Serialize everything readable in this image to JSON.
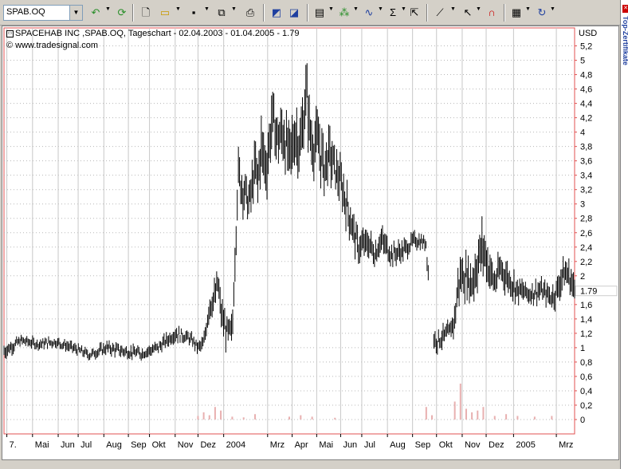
{
  "toolbar": {
    "symbol": "SPAB.OQ",
    "icons": [
      "undo-arrow-icon",
      "refresh-icon",
      "new-document-icon",
      "open-folder-icon",
      "save-icon",
      "copy-icon",
      "print-icon",
      "chart-in-icon",
      "chart-out-icon",
      "window-layout-icon",
      "indicator-icon",
      "study-icon",
      "sigma-icon",
      "export-icon",
      "draw-line-icon",
      "cursor-icon",
      "magnet-icon",
      "notes-icon",
      "rotate-icon"
    ]
  },
  "side": {
    "label": "Top-Zertifikate"
  },
  "chart": {
    "title": "SPACEHAB INC ,SPAB.OQ, Tageschart - 02.04.2003 - 01.04.2005 - 1.79",
    "source": "© www.tradesignal.com",
    "unit": "USD",
    "last_price_label": "1.79"
  },
  "chart_data": {
    "type": "bar",
    "title": "SPACEHAB INC ,SPAB.OQ, Tageschart - 02.04.2003 - 01.04.2005 - 1.79",
    "ylabel": "USD",
    "ylim": [
      -0.2,
      5.45
    ],
    "price_ticks": [
      5.2,
      5,
      4.8,
      4.6,
      4.4,
      4.2,
      4,
      3.8,
      3.6,
      3.4,
      3.2,
      3,
      2.8,
      2.6,
      2.4,
      2.2,
      2,
      1.79,
      1.6,
      1.4,
      1.2,
      1,
      0.8,
      0.6,
      0.4,
      0.2,
      0
    ],
    "price_tick_labels": [
      "5,2",
      "5",
      "4,8",
      "4,6",
      "4,4",
      "4,2",
      "4",
      "3,8",
      "3,6",
      "3,4",
      "3,2",
      "3",
      "2,8",
      "2,6",
      "2,4",
      "2,2",
      "2",
      "1.79",
      "1,6",
      "1,4",
      "1,2",
      "1",
      "0,8",
      "0,6",
      "0,4",
      "0,2",
      "0"
    ],
    "last_price": 1.79,
    "x_tick_labels": [
      "7.",
      "Mai",
      "Jun",
      "Jul",
      "Aug",
      "Sep",
      "Okt",
      "Nov",
      "Dez",
      "2004",
      "Mrz",
      "Apr",
      "Mai",
      "Jun",
      "Jul",
      "Aug",
      "Sep",
      "Okt",
      "Nov",
      "Dez",
      "2005",
      "Mrz"
    ],
    "x_tick_frac": [
      0.005,
      0.05,
      0.095,
      0.13,
      0.175,
      0.218,
      0.255,
      0.3,
      0.34,
      0.385,
      0.462,
      0.505,
      0.548,
      0.59,
      0.627,
      0.672,
      0.716,
      0.758,
      0.803,
      0.845,
      0.893,
      0.968
    ],
    "price_series": {
      "name": "SPAB.OQ",
      "t": [
        0,
        0.03,
        0.06,
        0.09,
        0.12,
        0.15,
        0.18,
        0.21,
        0.24,
        0.27,
        0.3,
        0.32,
        0.33,
        0.34,
        0.35,
        0.36,
        0.37,
        0.375,
        0.38,
        0.39,
        0.4,
        0.41,
        0.42,
        0.43,
        0.44,
        0.445,
        0.45,
        0.46,
        0.47,
        0.48,
        0.49,
        0.5,
        0.51,
        0.52,
        0.53,
        0.535,
        0.54,
        0.55,
        0.56,
        0.57,
        0.58,
        0.59,
        0.6,
        0.62,
        0.64,
        0.65,
        0.66,
        0.67,
        0.68,
        0.7,
        0.72,
        0.74,
        0.745,
        0.75,
        0.755,
        0.76,
        0.77,
        0.78,
        0.79,
        0.795,
        0.8,
        0.81,
        0.82,
        0.83,
        0.84,
        0.85,
        0.86,
        0.87,
        0.88,
        0.9,
        0.92,
        0.94,
        0.95,
        0.96,
        0.97,
        0.98,
        0.99,
        1.0
      ],
      "close": [
        0.95,
        1.1,
        1.05,
        1.08,
        1.0,
        0.9,
        1.0,
        0.95,
        0.92,
        1.0,
        1.2,
        1.15,
        1.1,
        1.0,
        1.05,
        1.6,
        1.7,
        1.9,
        1.5,
        1.2,
        1.2,
        3.4,
        3.2,
        3.0,
        3.5,
        3.3,
        3.8,
        3.5,
        4.2,
        3.9,
        4.0,
        3.6,
        4.0,
        3.8,
        4.6,
        4.1,
        3.8,
        3.9,
        3.5,
        3.7,
        3.5,
        3.3,
        3.0,
        2.4,
        2.45,
        2.3,
        2.5,
        2.4,
        2.3,
        2.35,
        2.5,
        2.45,
        1.85,
        1.2,
        1.1,
        1.1,
        1.15,
        1.2,
        1.4,
        1.8,
        2.0,
        2.0,
        1.9,
        2.2,
        2.4,
        2.1,
        1.9,
        2.1,
        2.0,
        1.8,
        1.75,
        1.8,
        1.75,
        1.7,
        1.8,
        2.05,
        2.0,
        1.79
      ],
      "range": [
        0.15,
        0.1,
        0.1,
        0.1,
        0.1,
        0.1,
        0.12,
        0.12,
        0.12,
        0.12,
        0.15,
        0.12,
        0.12,
        0.12,
        0.15,
        0.3,
        0.3,
        0.3,
        0.3,
        0.3,
        0.3,
        0.5,
        0.4,
        0.4,
        0.5,
        0.5,
        0.6,
        0.5,
        0.6,
        0.5,
        0.6,
        0.6,
        0.6,
        0.6,
        0.6,
        0.6,
        0.5,
        0.5,
        0.6,
        0.5,
        0.4,
        0.4,
        0.4,
        0.3,
        0.3,
        0.25,
        0.25,
        0.25,
        0.2,
        0.2,
        0.15,
        0.15,
        0.3,
        0.3,
        0.2,
        0.2,
        0.2,
        0.2,
        0.3,
        0.4,
        0.4,
        0.4,
        0.4,
        0.5,
        0.5,
        0.4,
        0.3,
        0.3,
        0.3,
        0.25,
        0.2,
        0.2,
        0.2,
        0.2,
        0.3,
        0.3,
        0.3,
        0.3
      ]
    },
    "volume_series": {
      "name": "Volume",
      "t": [
        0.34,
        0.35,
        0.36,
        0.37,
        0.38,
        0.4,
        0.42,
        0.44,
        0.5,
        0.52,
        0.54,
        0.58,
        0.74,
        0.75,
        0.79,
        0.8,
        0.81,
        0.82,
        0.83,
        0.84,
        0.86,
        0.88,
        0.9,
        0.93,
        0.96
      ],
      "v": [
        0.1,
        0.2,
        0.12,
        0.35,
        0.25,
        0.08,
        0.06,
        0.15,
        0.08,
        0.12,
        0.08,
        0.05,
        0.35,
        0.12,
        0.5,
        1.0,
        0.3,
        0.2,
        0.25,
        0.35,
        0.1,
        0.15,
        0.1,
        0.08,
        0.1
      ]
    },
    "grid": true,
    "legend": "none"
  }
}
